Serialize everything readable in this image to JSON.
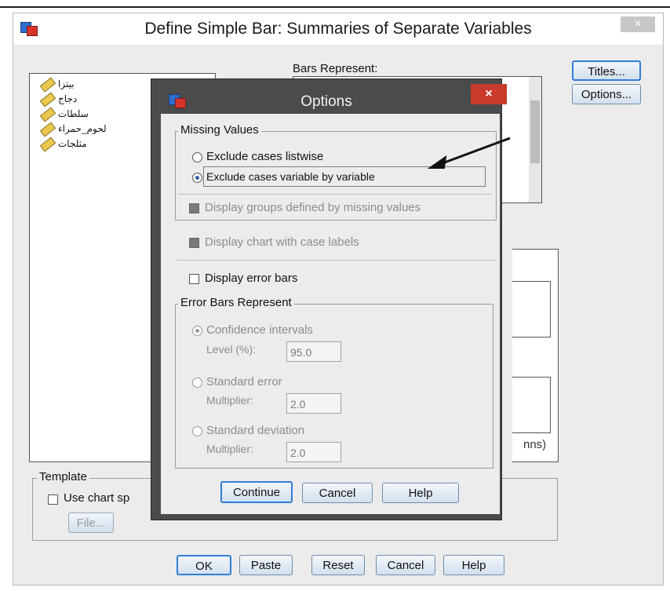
{
  "window": {
    "title": "Define Simple Bar: Summaries of Separate Variables",
    "close_label": "×"
  },
  "variables": [
    "بيتزا",
    "دجاج",
    "سلطات",
    "لحوم_حمراء",
    "مثلجات"
  ],
  "bars_represent_label": "Bars Represent:",
  "side_buttons": {
    "titles": "Titles...",
    "options": "Options..."
  },
  "partial_text": "nns)",
  "template": {
    "group_label": "Template",
    "use_chart_label": "Use chart sp",
    "file_label": "File..."
  },
  "bottom_buttons": {
    "ok": "OK",
    "paste": "Paste",
    "reset": "Reset",
    "cancel": "Cancel",
    "help": "Help"
  },
  "options_dialog": {
    "title": "Options",
    "close_label": "×",
    "missing_values": {
      "group_label": "Missing Values",
      "listwise": "Exclude cases listwise",
      "variable_by_variable": "Exclude cases variable by variable",
      "selected": "variable_by_variable",
      "display_groups": "Display groups defined by missing values"
    },
    "display_case_labels": "Display chart with case labels",
    "display_error_bars": "Display error bars",
    "error_bars": {
      "group_label": "Error Bars Represent",
      "confidence": "Confidence intervals",
      "level_label": "Level (%):",
      "level_value": "95.0",
      "standard_error": "Standard error",
      "se_multiplier_label": "Multiplier:",
      "se_multiplier_value": "2.0",
      "standard_deviation": "Standard deviation",
      "sd_multiplier_label": "Multiplier:",
      "sd_multiplier_value": "2.0"
    },
    "buttons": {
      "continue": "Continue",
      "cancel": "Cancel",
      "help": "Help"
    }
  },
  "colors": {
    "accent": "#2f7fd6",
    "close_red": "#c83a2a",
    "dialog_frame": "#4b4b4b",
    "variable_icon": "#e9c84e"
  }
}
